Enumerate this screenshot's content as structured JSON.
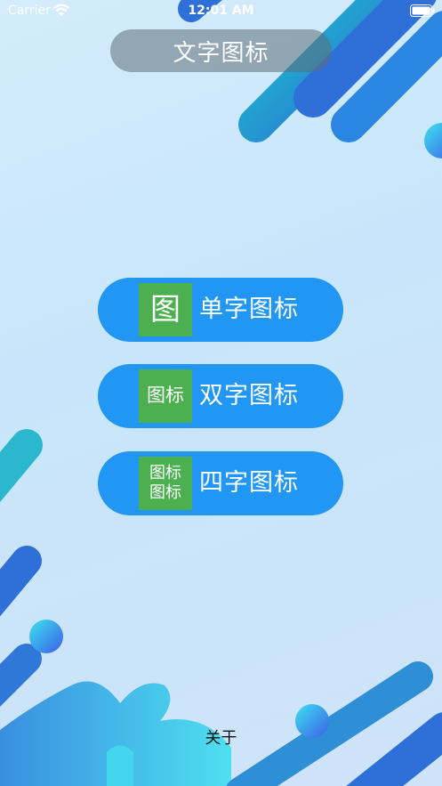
{
  "status_bar": {
    "carrier": "Carrier",
    "time": "12:01 AM"
  },
  "header": {
    "title": "文字图标"
  },
  "menu": {
    "items": [
      {
        "icon_lines": [
          "图"
        ],
        "label": "单字图标"
      },
      {
        "icon_lines": [
          "图标"
        ],
        "label": "双字图标"
      },
      {
        "icon_lines": [
          "图标",
          "图标"
        ],
        "label": "四字图标"
      }
    ]
  },
  "footer": {
    "about": "关于"
  },
  "colors": {
    "button_bg": "#2196f3",
    "icon_bg": "#4caf50",
    "title_pill_bg": "#5f6e78",
    "shape_blue": "#2f6fd8",
    "shape_teal": "#1fb5c7"
  }
}
